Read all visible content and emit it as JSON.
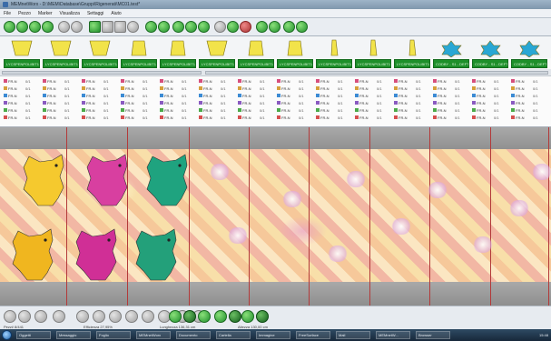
{
  "window": {
    "title": "MEMnetWorx - D:\\MEM\\Database\\Gruppi\\Rigenerati\\MC01.test*"
  },
  "menu": [
    "File",
    "Pezzo",
    "Marker",
    "Visualizza",
    "Settaggi",
    "Aiuto"
  ],
  "toolbar_icons": [
    "new-icon",
    "open-icon",
    "save-icon",
    "print-icon",
    "undo-icon",
    "redo-icon",
    "select-icon",
    "copy-icon",
    "paste-icon",
    "cut-icon",
    "rotate-icon",
    "flip-icon",
    "mirror-icon",
    "zoom-in-icon",
    "zoom-out-icon",
    "zoom-fit-icon",
    "measure-icon",
    "nest-icon",
    "stop-icon",
    "user-icon",
    "settings-icon",
    "help-icon"
  ],
  "pieces": [
    {
      "label": "LYCSPENPOLIBIT1 - C",
      "shape": "trapezoid-wide",
      "color": "#f2e34a"
    },
    {
      "label": "LYCSPENPOLIBIT1 - C",
      "shape": "trapezoid-wide",
      "color": "#f2e34a"
    },
    {
      "label": "LYCSPENPOLIBIT1 - C",
      "shape": "trapezoid-wide",
      "color": "#f2e34a"
    },
    {
      "label": "LYCSPENPOLIBIT1 - C",
      "shape": "trapezoid-narrow",
      "color": "#f2e34a"
    },
    {
      "label": "LYCSPENPOLIBIT1 - C",
      "shape": "trapezoid-narrow",
      "color": "#f2e34a"
    },
    {
      "label": "LYCSPENPOLIBIT1 - C",
      "shape": "trapezoid-wide",
      "color": "#f2e34a"
    },
    {
      "label": "LYCSPENPOLIBIT1 - C",
      "shape": "trapezoid-narrow",
      "color": "#f2e34a"
    },
    {
      "label": "LYCSPENPOLIBIT1 - C",
      "shape": "trapezoid-narrow",
      "color": "#f2e34a"
    },
    {
      "label": "LYCSPENPOLIBIT1 - C",
      "shape": "sliver",
      "color": "#f2e34a"
    },
    {
      "label": "LYCSPENPOLIBIT1 - C",
      "shape": "sliver",
      "color": "#f2e34a"
    },
    {
      "label": "LYCSPENPOLIBIT1 - C",
      "shape": "sliver",
      "color": "#f2e34a"
    },
    {
      "label": "CODBY - S1 - DEFT",
      "shape": "star",
      "color": "#29a7d4"
    },
    {
      "label": "CODBY - S1 - DEFT",
      "shape": "star",
      "color": "#29a7d4"
    },
    {
      "label": "CODBY - S1 - DEFT",
      "shape": "star",
      "color": "#29a7d4"
    }
  ],
  "property_rows": [
    {
      "name": "FR-N",
      "value": "0/1",
      "color": "#d64f7d"
    },
    {
      "name": "FR-N",
      "value": "0/1",
      "color": "#d6a03a"
    },
    {
      "name": "FR-N",
      "value": "0/1",
      "color": "#3c8bd4"
    },
    {
      "name": "FR-N",
      "value": "0/1",
      "color": "#8a5bc1"
    },
    {
      "name": "FR-N",
      "value": "0/1",
      "color": "#4caa4a"
    },
    {
      "name": "FR-N",
      "value": "0/1",
      "color": "#d64f4f"
    }
  ],
  "nest_pieces": [
    {
      "color": "#f5c92e",
      "row": 0,
      "col": 0
    },
    {
      "color": "#d83fa0",
      "row": 0,
      "col": 1
    },
    {
      "color": "#1fa37f",
      "row": 0,
      "col": 2
    },
    {
      "color": "#f0b61f",
      "row": 1,
      "col": 0
    },
    {
      "color": "#d02f96",
      "row": 1,
      "col": 1
    },
    {
      "color": "#23a07a",
      "row": 1,
      "col": 2
    }
  ],
  "status": {
    "pezzi": "Pezzi/ 8/441",
    "efficienza": "Efficienza 27,95%",
    "lunghezza": "Lunghezza 136,31 cm",
    "altezza": "Altezza 130,00 cm"
  },
  "taskbar": {
    "tasks": [
      "Oggetti",
      "Messaggio",
      "Foglio",
      "MEMnetWorx",
      "Documento",
      "Cartella",
      "Immagine",
      "FreeSurface",
      "Mail",
      "MEMnetW...",
      "Browser"
    ],
    "clock": "15:48"
  }
}
